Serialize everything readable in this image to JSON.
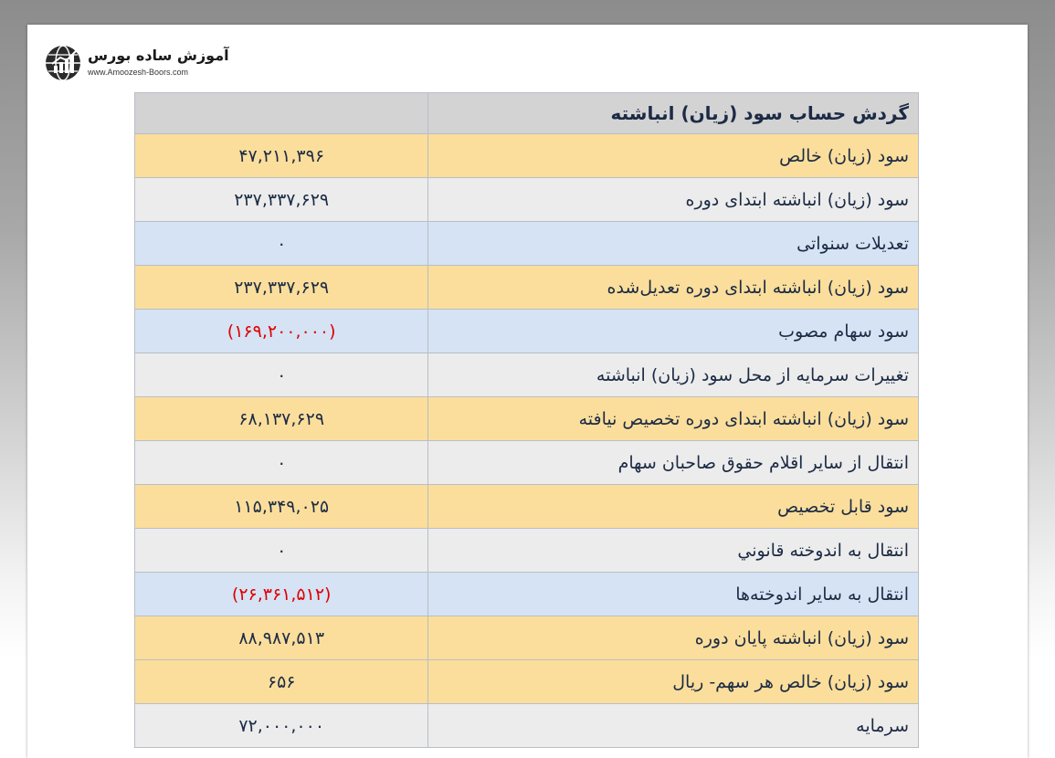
{
  "logo": {
    "title": "آموزش ساده بورس",
    "url": "www.Amoozesh-Boors.com",
    "icon": "globe-chart-icon"
  },
  "table": {
    "title": "گردش حساب سود (زیان) انباشته",
    "rows": [
      {
        "label": "سود (زیان) خالص",
        "value": "۴۷,۲۱۱,۳۹۶",
        "color": "yellow",
        "negative": false
      },
      {
        "label": "سود (زیان) انباشته ابتدای دوره",
        "value": "۲۳۷,۳۳۷,۶۲۹",
        "color": "gray",
        "negative": false
      },
      {
        "label": "تعدیلات سنواتی",
        "value": "۰",
        "color": "blue",
        "negative": false
      },
      {
        "label": "سود (زیان) انباشته ابتدای دوره تعدیل‌شده",
        "value": "۲۳۷,۳۳۷,۶۲۹",
        "color": "yellow",
        "negative": false
      },
      {
        "label": "سود سهام مصوب",
        "value": "(۱۶۹,۲۰۰,۰۰۰)",
        "color": "blue",
        "negative": true
      },
      {
        "label": "تغییرات سرمایه از محل سود (زیان) انباشته",
        "value": "۰",
        "color": "gray",
        "negative": false
      },
      {
        "label": "سود (زیان) انباشته ابتدای دوره تخصیص نیافته",
        "value": "۶۸,۱۳۷,۶۲۹",
        "color": "yellow",
        "negative": false
      },
      {
        "label": "انتقال از سایر اقلام حقوق صاحبان سهام",
        "value": "۰",
        "color": "gray",
        "negative": false
      },
      {
        "label": "سود قابل تخصیص",
        "value": "۱۱۵,۳۴۹,۰۲۵",
        "color": "yellow",
        "negative": false
      },
      {
        "label": "انتقال به اندوخته قانوني",
        "value": "۰",
        "color": "gray",
        "negative": false
      },
      {
        "label": "انتقال به سایر اندوخته‌ها",
        "value": "(۲۶,۳۶۱,۵۱۲)",
        "color": "blue",
        "negative": true
      },
      {
        "label": "سود (زیان) انباشته پایان دوره",
        "value": "۸۸,۹۸۷,۵۱۳",
        "color": "yellow",
        "negative": false
      },
      {
        "label": "سود (زیان) خالص هر سهم- ریال",
        "value": "۶۵۶",
        "color": "yellow",
        "negative": false
      },
      {
        "label": "سرمایه",
        "value": "۷۲,۰۰۰,۰۰۰",
        "color": "gray",
        "negative": false
      }
    ]
  },
  "colors": {
    "yellow": "#fbde9b",
    "gray": "#ececec",
    "blue": "#d5e3f4",
    "header": "#d3d3d3",
    "negative_text": "#e00000"
  }
}
